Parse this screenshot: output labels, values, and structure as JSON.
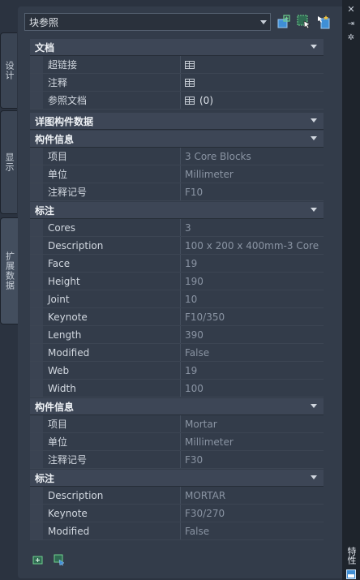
{
  "palette_tabs": {
    "design": "设计",
    "display": "显示",
    "extended_data": "扩展数据"
  },
  "side_title": "特性",
  "dropdown": {
    "value": "块参照"
  },
  "sections": {
    "doc": {
      "title": "文档",
      "rows": [
        {
          "name": "超链接",
          "value": ""
        },
        {
          "name": "注释",
          "value": ""
        },
        {
          "name": "参照文档",
          "value": "(0)"
        }
      ]
    },
    "detail": {
      "title": "详图构件数据"
    },
    "comp1": {
      "title": "构件信息",
      "rows": [
        {
          "name": "项目",
          "value": "3 Core Blocks"
        },
        {
          "name": "单位",
          "value": "Millimeter"
        },
        {
          "name": "注释记号",
          "value": "F10"
        }
      ]
    },
    "note1": {
      "title": "标注",
      "rows": [
        {
          "name": "Cores",
          "value": "3"
        },
        {
          "name": "Description",
          "value": "100 x 200 x 400mm-3 Core"
        },
        {
          "name": "Face",
          "value": "19"
        },
        {
          "name": "Height",
          "value": "190"
        },
        {
          "name": "Joint",
          "value": "10"
        },
        {
          "name": "Keynote",
          "value": "F10/350"
        },
        {
          "name": "Length",
          "value": "390"
        },
        {
          "name": "Modified",
          "value": "False"
        },
        {
          "name": "Web",
          "value": "19"
        },
        {
          "name": "Width",
          "value": "100"
        }
      ]
    },
    "comp2": {
      "title": "构件信息",
      "rows": [
        {
          "name": "项目",
          "value": "Mortar"
        },
        {
          "name": "单位",
          "value": "Millimeter"
        },
        {
          "name": "注释记号",
          "value": "F30"
        }
      ]
    },
    "note2": {
      "title": "标注",
      "rows": [
        {
          "name": "Description",
          "value": "MORTAR"
        },
        {
          "name": "Keynote",
          "value": "F30/270"
        },
        {
          "name": "Modified",
          "value": "False"
        }
      ]
    }
  },
  "colors": {
    "accent_blue": "#3f8fd6",
    "accent_green": "#3fb37a"
  }
}
